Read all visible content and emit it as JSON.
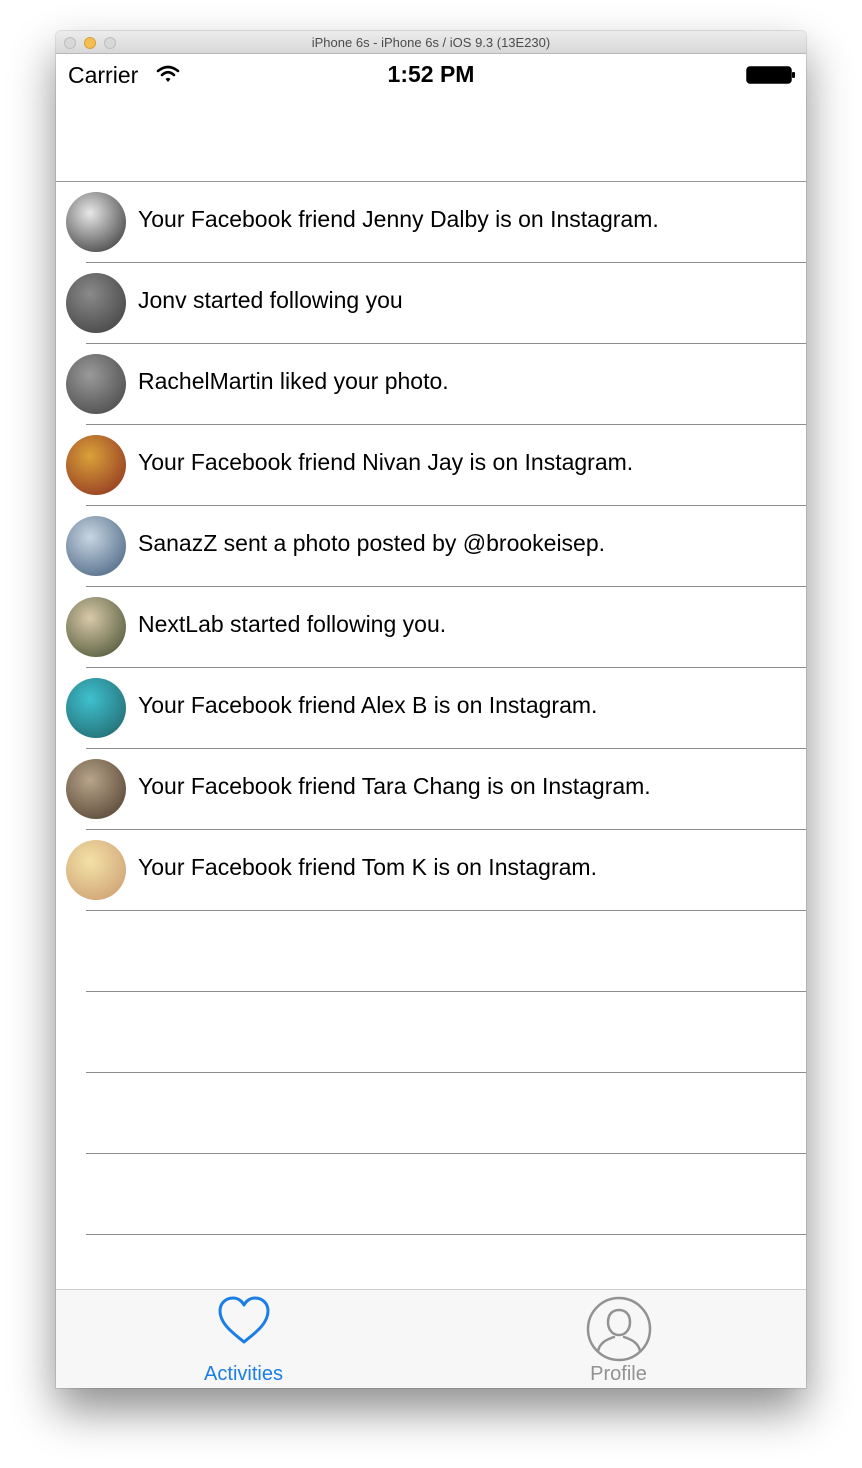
{
  "window": {
    "title": "iPhone 6s - iPhone 6s / iOS 9.3 (13E230)"
  },
  "status_bar": {
    "carrier": "Carrier",
    "time": "1:52 PM"
  },
  "activities": [
    {
      "text": "Your Facebook friend Jenny Dalby is on Instagram.",
      "avatar_colors": [
        "#e8e8e8",
        "#2a2a2a"
      ]
    },
    {
      "text": "Jonv started following you",
      "avatar_colors": [
        "#8a8a8a",
        "#3b3b3b"
      ]
    },
    {
      "text": "RachelMartin liked your photo.",
      "avatar_colors": [
        "#9a9a9a",
        "#404040"
      ]
    },
    {
      "text": "Your Facebook friend Nivan Jay is on Instagram.",
      "avatar_colors": [
        "#d9a23a",
        "#8a2a1e"
      ]
    },
    {
      "text": "SanazZ sent a photo posted by @brookeisep.",
      "avatar_colors": [
        "#c9d6e2",
        "#3d5a7a"
      ]
    },
    {
      "text": "NextLab started following you.",
      "avatar_colors": [
        "#d8c9a8",
        "#3f4a2c"
      ]
    },
    {
      "text": "Your Facebook friend Alex B is on Instagram.",
      "avatar_colors": [
        "#3fc1cf",
        "#1f5f64"
      ]
    },
    {
      "text": "Your Facebook friend Tara Chang is on Instagram.",
      "avatar_colors": [
        "#b8a48a",
        "#4a3a2a"
      ]
    },
    {
      "text": "Your Facebook friend Tom K is on Instagram.",
      "avatar_colors": [
        "#f4e2a6",
        "#c8986e"
      ]
    }
  ],
  "tab_bar": {
    "tabs": [
      {
        "label": "Activities",
        "icon": "heart-icon",
        "selected": true,
        "color": "#1a7ee6"
      },
      {
        "label": "Profile",
        "icon": "profile-icon",
        "selected": false,
        "color": "#929292"
      }
    ]
  }
}
